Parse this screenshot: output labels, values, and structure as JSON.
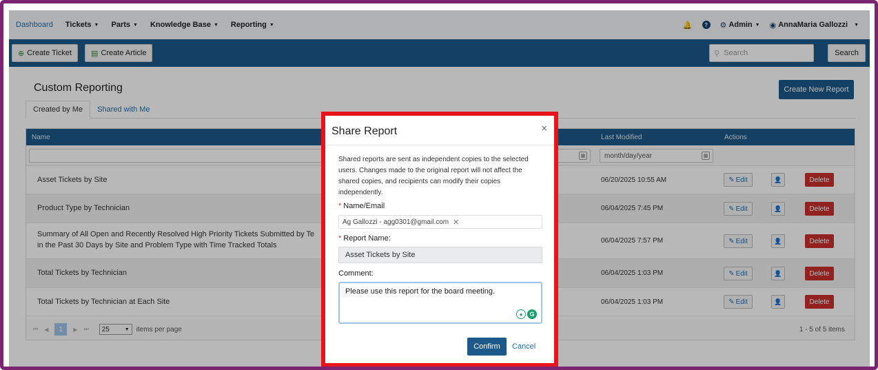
{
  "topnav": {
    "items": [
      {
        "label": "Dashboard",
        "active": true
      },
      {
        "label": "Tickets",
        "active": false
      },
      {
        "label": "Parts",
        "active": false
      },
      {
        "label": "Knowledge Base",
        "active": false
      },
      {
        "label": "Reporting",
        "active": false
      }
    ],
    "admin_label": "Admin",
    "user_name": "AnnaMaria Gallozzi"
  },
  "actionbar": {
    "create_ticket": "Create Ticket",
    "create_article": "Create Article",
    "search_placeholder": "Search",
    "search_button": "Search"
  },
  "page": {
    "title": "Custom Reporting",
    "create_report_button": "Create New Report",
    "tabs": [
      {
        "label": "Created by Me",
        "active": true
      },
      {
        "label": "Shared with Me",
        "active": false
      }
    ]
  },
  "grid": {
    "columns": {
      "name": "Name",
      "last_modified": "Last Modified",
      "actions": "Actions"
    },
    "date_filter_placeholder": "month/day/year",
    "rows": [
      {
        "name": "Asset Tickets by Site",
        "date": "06/20/2025 10:55 AM"
      },
      {
        "name": "Product Type by Technician",
        "date": "06/04/2025 7:45 PM"
      },
      {
        "name": "Summary of All Open and Recently Resolved High Priority Tickets Submitted by Te",
        "name2": "in the Past 30 Days by Site and Problem Type with Time Tracked Totals",
        "date": "06/04/2025 7:57 PM"
      },
      {
        "name": "Total Tickets by Technician",
        "date": "06/04/2025 1:03 PM"
      },
      {
        "name": "Total Tickets by Technician at Each Site",
        "date": "06/04/2025 1:03 PM"
      }
    ],
    "edit_label": "Edit",
    "delete_label": "Delete",
    "pager": {
      "page": "1",
      "per_page": "25",
      "per_page_label": "items per page",
      "count": "1 - 5 of 5 items"
    }
  },
  "modal": {
    "title": "Share Report",
    "close": "×",
    "description": "Shared reports are sent as independent copies to the selected users. Changes made to the original report will not affect the shared copies, and recipients can modify their copies independently.",
    "name_email_label": "Name/Email",
    "recipient_chip": "Ag Gallozzi - agg0301@gmail.com",
    "report_name_label": "Report Name:",
    "report_name_value": "Asset Tickets by Site",
    "comment_label": "Comment:",
    "comment_value": "Please use this report for the board meeting.",
    "confirm": "Confirm",
    "cancel": "Cancel"
  }
}
